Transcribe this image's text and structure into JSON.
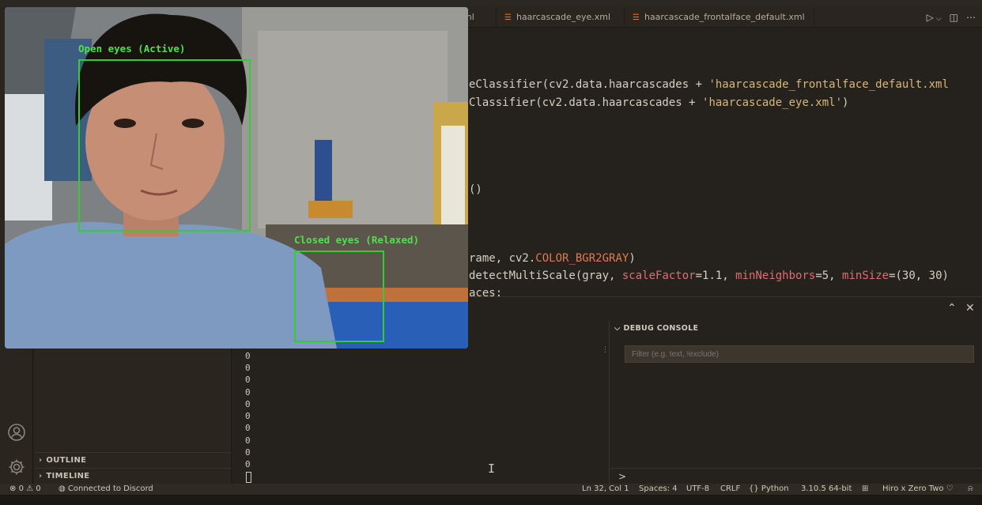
{
  "tabs": [
    {
      "label": "ml"
    },
    {
      "label": "haarcascade_eye.xml"
    },
    {
      "label": "haarcascade_frontalface_default.xml"
    }
  ],
  "tab_actions": {
    "run_icon": "play-icon",
    "split_icon": "split-editor-icon",
    "more_icon": "more-icon"
  },
  "code": {
    "l1": {
      "a": "eClassifier(cv2.data.haarcascades + ",
      "b": "'haarcascade_frontalface_default.xml"
    },
    "l2": {
      "a": "Classifier(cv2.data.haarcascades + ",
      "b": "'haarcascade_eye.xml'",
      "c": ")"
    },
    "l3": "()",
    "l4": {
      "a": "rame, cv2.",
      "b": "COLOR_BGR2GRAY",
      "c": ")"
    },
    "l5": {
      "a": "detectMultiScale(gray, ",
      "p1": "scaleFactor",
      "v1": "=1.1, ",
      "p2": "minNeighbors",
      "v2": "=5, ",
      "p3": "minSize",
      "v3": "=(30, 30)"
    },
    "l6": "aces:"
  },
  "panel": {
    "debug_title": "DEBUG CONSOLE",
    "filter_placeholder": "Filter (e.g. text, !exclude)",
    "prompt": ">",
    "terminal_lines": [
      "0",
      "0",
      "0",
      "0",
      "0",
      "0",
      "0",
      "0",
      "0",
      "0"
    ]
  },
  "sidebar": {
    "outline": "OUTLINE",
    "timeline": "TIMELINE"
  },
  "statusbar": {
    "errors": "0",
    "warnings": "0",
    "discord": "Connected to Discord",
    "position": "Ln 32, Col 1",
    "spaces": "Spaces: 4",
    "encoding": "UTF-8",
    "eol": "CRLF",
    "language": "Python",
    "interpreter": "3.10.5 64-bit",
    "theme": "Hiro x Zero Two"
  },
  "webcam": {
    "open_label": "Open eyes (Active)",
    "closed_label": "Closed eyes (Relaxed)"
  },
  "colors": {
    "detection": "#33cc33",
    "label": "#4ee04e",
    "editor_bg": "#25211c",
    "string": "#d8b77a",
    "param": "#e06c75"
  }
}
